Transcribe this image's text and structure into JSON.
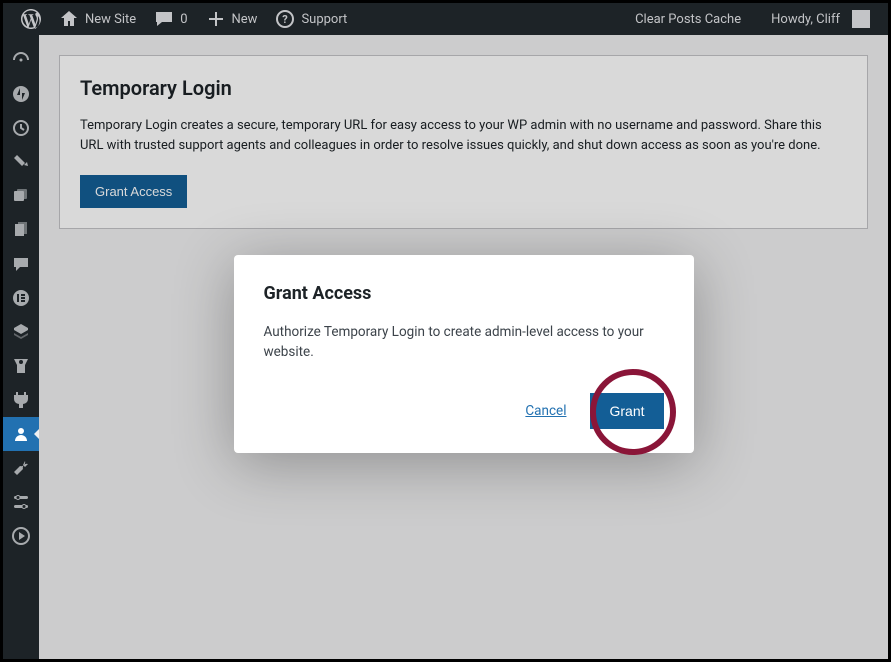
{
  "toolbar": {
    "site_name": "New Site",
    "comments_count": "0",
    "new_label": "New",
    "support_label": "Support",
    "clear_cache": "Clear Posts Cache",
    "howdy": "Howdy, Cliff"
  },
  "sidebar": {
    "items": [
      {
        "name": "dashboard"
      },
      {
        "name": "jetpack"
      },
      {
        "name": "activity"
      },
      {
        "name": "posts"
      },
      {
        "name": "media"
      },
      {
        "name": "pages"
      },
      {
        "name": "comments"
      },
      {
        "name": "elementor"
      },
      {
        "name": "templates"
      },
      {
        "name": "appearance"
      },
      {
        "name": "plugins"
      },
      {
        "name": "users"
      },
      {
        "name": "tools"
      },
      {
        "name": "settings"
      },
      {
        "name": "playback"
      }
    ]
  },
  "panel": {
    "title": "Temporary Login",
    "description": "Temporary Login creates a secure, temporary URL for easy access to your WP admin with no username and password. Share this URL with trusted support agents and colleagues in order to resolve issues quickly, and shut down access as soon as you're done.",
    "button": "Grant Access"
  },
  "modal": {
    "title": "Grant Access",
    "body": "Authorize Temporary Login to create admin-level access to your website.",
    "cancel": "Cancel",
    "confirm": "Grant"
  }
}
